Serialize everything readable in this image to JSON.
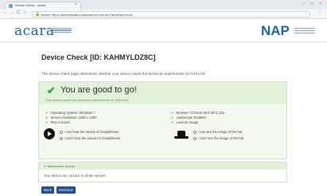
{
  "browser": {
    "tab_title": "Device Check - acara",
    "tab_close": "×",
    "window_controls": "– □ ×",
    "nav_back": "←",
    "nav_forward": "→",
    "nav_reload": "C",
    "nav_home": "⌂",
    "lock": "🔒",
    "url": "Secure  https://administration.assessform.edu.au/?inDeviceCheck",
    "star": "☆",
    "menu": "⋮"
  },
  "header": {
    "logo_left": "acara",
    "logo_right": "NAP"
  },
  "page": {
    "title": "Device Check [ID: KAHMYLDZ8C]",
    "description": "This device check page determines whether your device meets the technical requirements for NAPLAN."
  },
  "result": {
    "check": "✔",
    "headline": "You are good to go!",
    "subline": "Your device meets the technical requirements for NAPLAN.",
    "left_checks": [
      "Operating System: Windows 7",
      "Screen resolution: 1080 x 1920",
      "Play a sound"
    ],
    "right_checks": [
      "Browser: Chrome 59.0.3071.115",
      "JavaScript: Enabled",
      "Load an image"
    ],
    "sound_options": [
      "I can hear the sound on headphones",
      "I can't hear the sound on headphones"
    ],
    "image_options": [
      "I can see the image of the hat.",
      "I can't see the image of the hat."
    ]
  },
  "server": {
    "title": "✔ Webservice access",
    "body": "Your device can connect to all the servers."
  },
  "buttons": {
    "back": "Back",
    "recheck": "Recheck"
  },
  "colors": {
    "brand": "#1f5fa8",
    "success": "#3aa04a",
    "button": "#1f4e8c"
  }
}
